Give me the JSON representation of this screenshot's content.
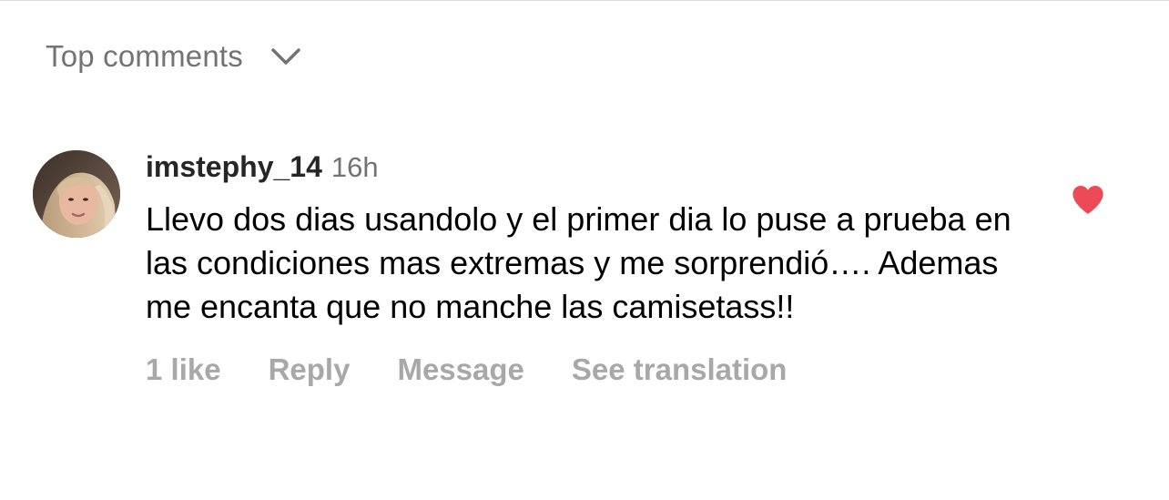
{
  "sort": {
    "label": "Top comments",
    "icon": "chevron-down-icon"
  },
  "comment": {
    "avatar_icon": "avatar",
    "username": "imstephy_14",
    "timestamp": "16h",
    "text": "Llevo dos dias usandolo y el primer dia lo puse a prueba en las condiciones mas extremas y me sorprendió…. Ademas me encanta que no manche las camisetass!!",
    "liked": true,
    "heart_color": "#ed4956",
    "actions": {
      "likes": "1 like",
      "reply": "Reply",
      "message": "Message",
      "translate": "See translation"
    }
  }
}
